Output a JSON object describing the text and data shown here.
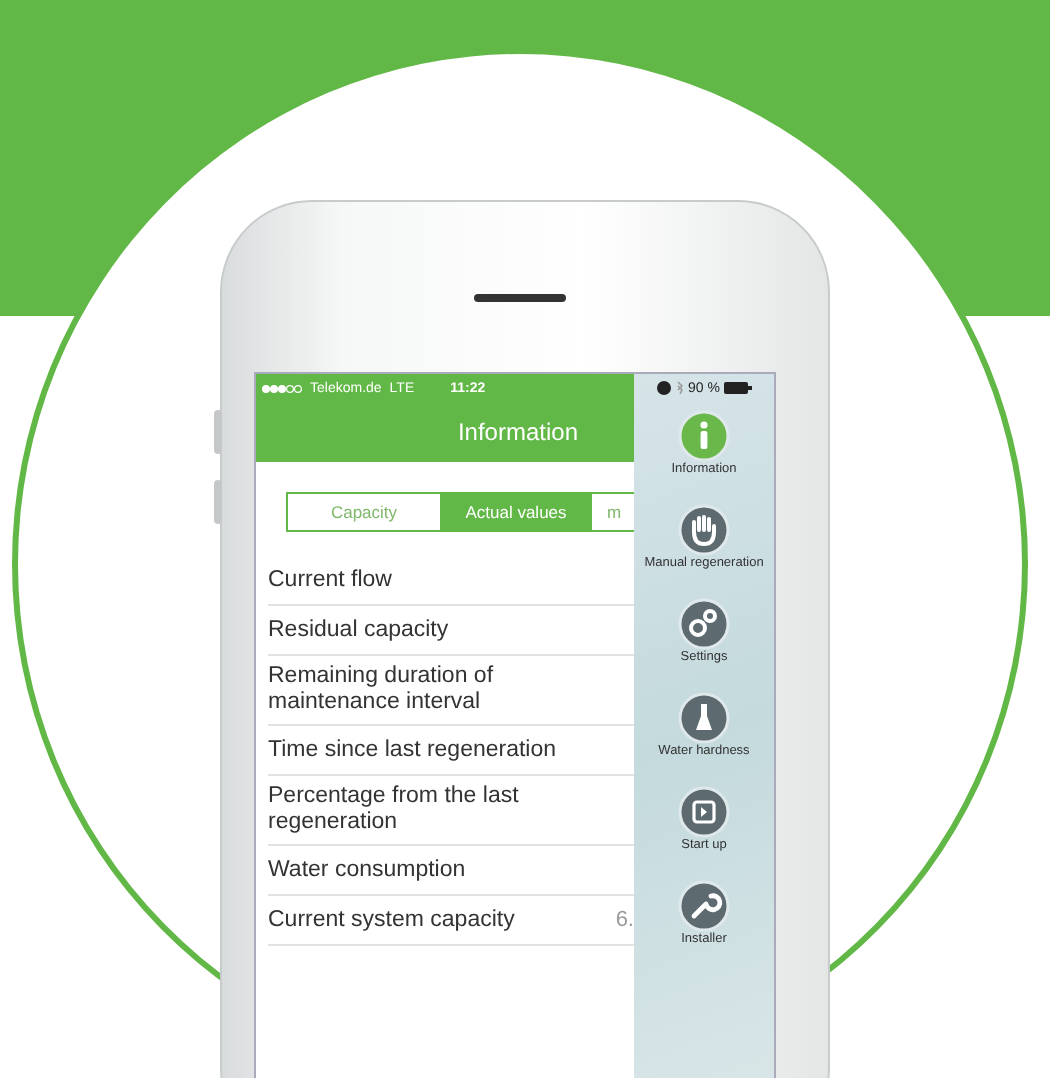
{
  "status_bar": {
    "carrier": "Telekom.de",
    "network": "LTE",
    "time": "11:22",
    "battery": "90 %"
  },
  "header": {
    "title": "Information"
  },
  "tabs": [
    {
      "label": "Capacity",
      "selected": false
    },
    {
      "label": "Actual values",
      "selected": true
    },
    {
      "label": "m",
      "selected": false
    }
  ],
  "rows": [
    {
      "label": "Current flow"
    },
    {
      "label": "Residual capacity"
    },
    {
      "label": "Remaining duration of maintenance interval"
    },
    {
      "label": "Time since last regeneration"
    },
    {
      "label": "Percentage from the last regeneration"
    },
    {
      "label": "Water consumption"
    },
    {
      "label": "Current system capacity",
      "value": "6."
    }
  ],
  "side_menu": [
    {
      "label": "Information",
      "kind": "info",
      "selected": true
    },
    {
      "label": "Manual regeneration",
      "kind": "hand",
      "selected": false
    },
    {
      "label": "Settings",
      "kind": "gears",
      "selected": false
    },
    {
      "label": "Water hardness",
      "kind": "flask",
      "selected": false
    },
    {
      "label": "Start up",
      "kind": "start",
      "selected": false
    },
    {
      "label": "Installer",
      "kind": "wrench",
      "selected": false
    }
  ]
}
